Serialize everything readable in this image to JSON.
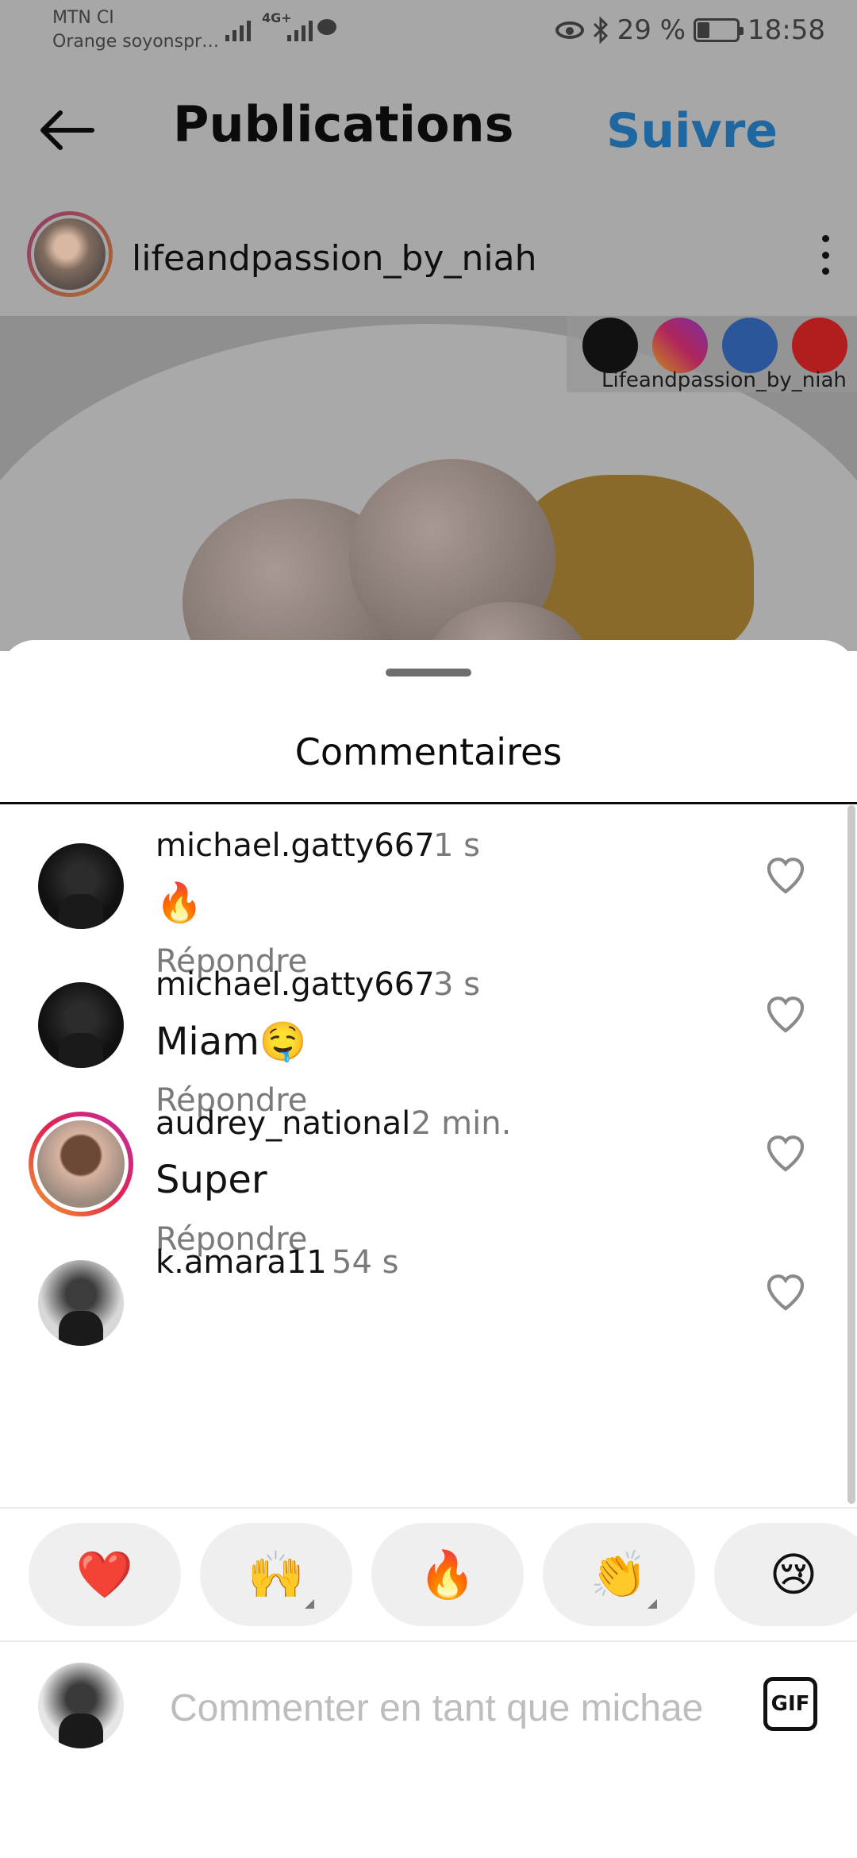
{
  "status_bar": {
    "carrier_1": "MTN CI",
    "carrier_2": "Orange soyonspr…",
    "network": "4G+",
    "battery": "29 %",
    "time": "18:58"
  },
  "header": {
    "title": "Publications",
    "follow_label": "Suivre"
  },
  "post": {
    "author": "lifeandpassion_by_niah",
    "overlay_handle": "Lifeandpassion_by_niah",
    "social_icons": [
      "tiktok-icon",
      "instagram-icon",
      "facebook-icon",
      "youtube-icon"
    ]
  },
  "comments_sheet": {
    "title": "Commentaires",
    "items": [
      {
        "user": "michael.gatty667",
        "time": "1 s",
        "text": "🔥",
        "reply": "Répondre"
      },
      {
        "user": "michael.gatty667",
        "time": "3 s",
        "text": "Miam🤤",
        "reply": "Répondre"
      },
      {
        "user": "audrey_national",
        "time": "2 min.",
        "text": "Super",
        "reply": "Répondre"
      },
      {
        "user": "k.amara11",
        "time": "54 s",
        "text": "",
        "reply": ""
      }
    ]
  },
  "reactions": [
    "❤️",
    "🙌",
    "🔥",
    "👏",
    "😢"
  ],
  "composer": {
    "placeholder": "Commenter en tant que michae",
    "gif_label": "GIF"
  },
  "colors": {
    "follow_blue": "#1e67a1",
    "dim_overlay": "#a7a7a7",
    "reaction_chip": "#efefef"
  }
}
